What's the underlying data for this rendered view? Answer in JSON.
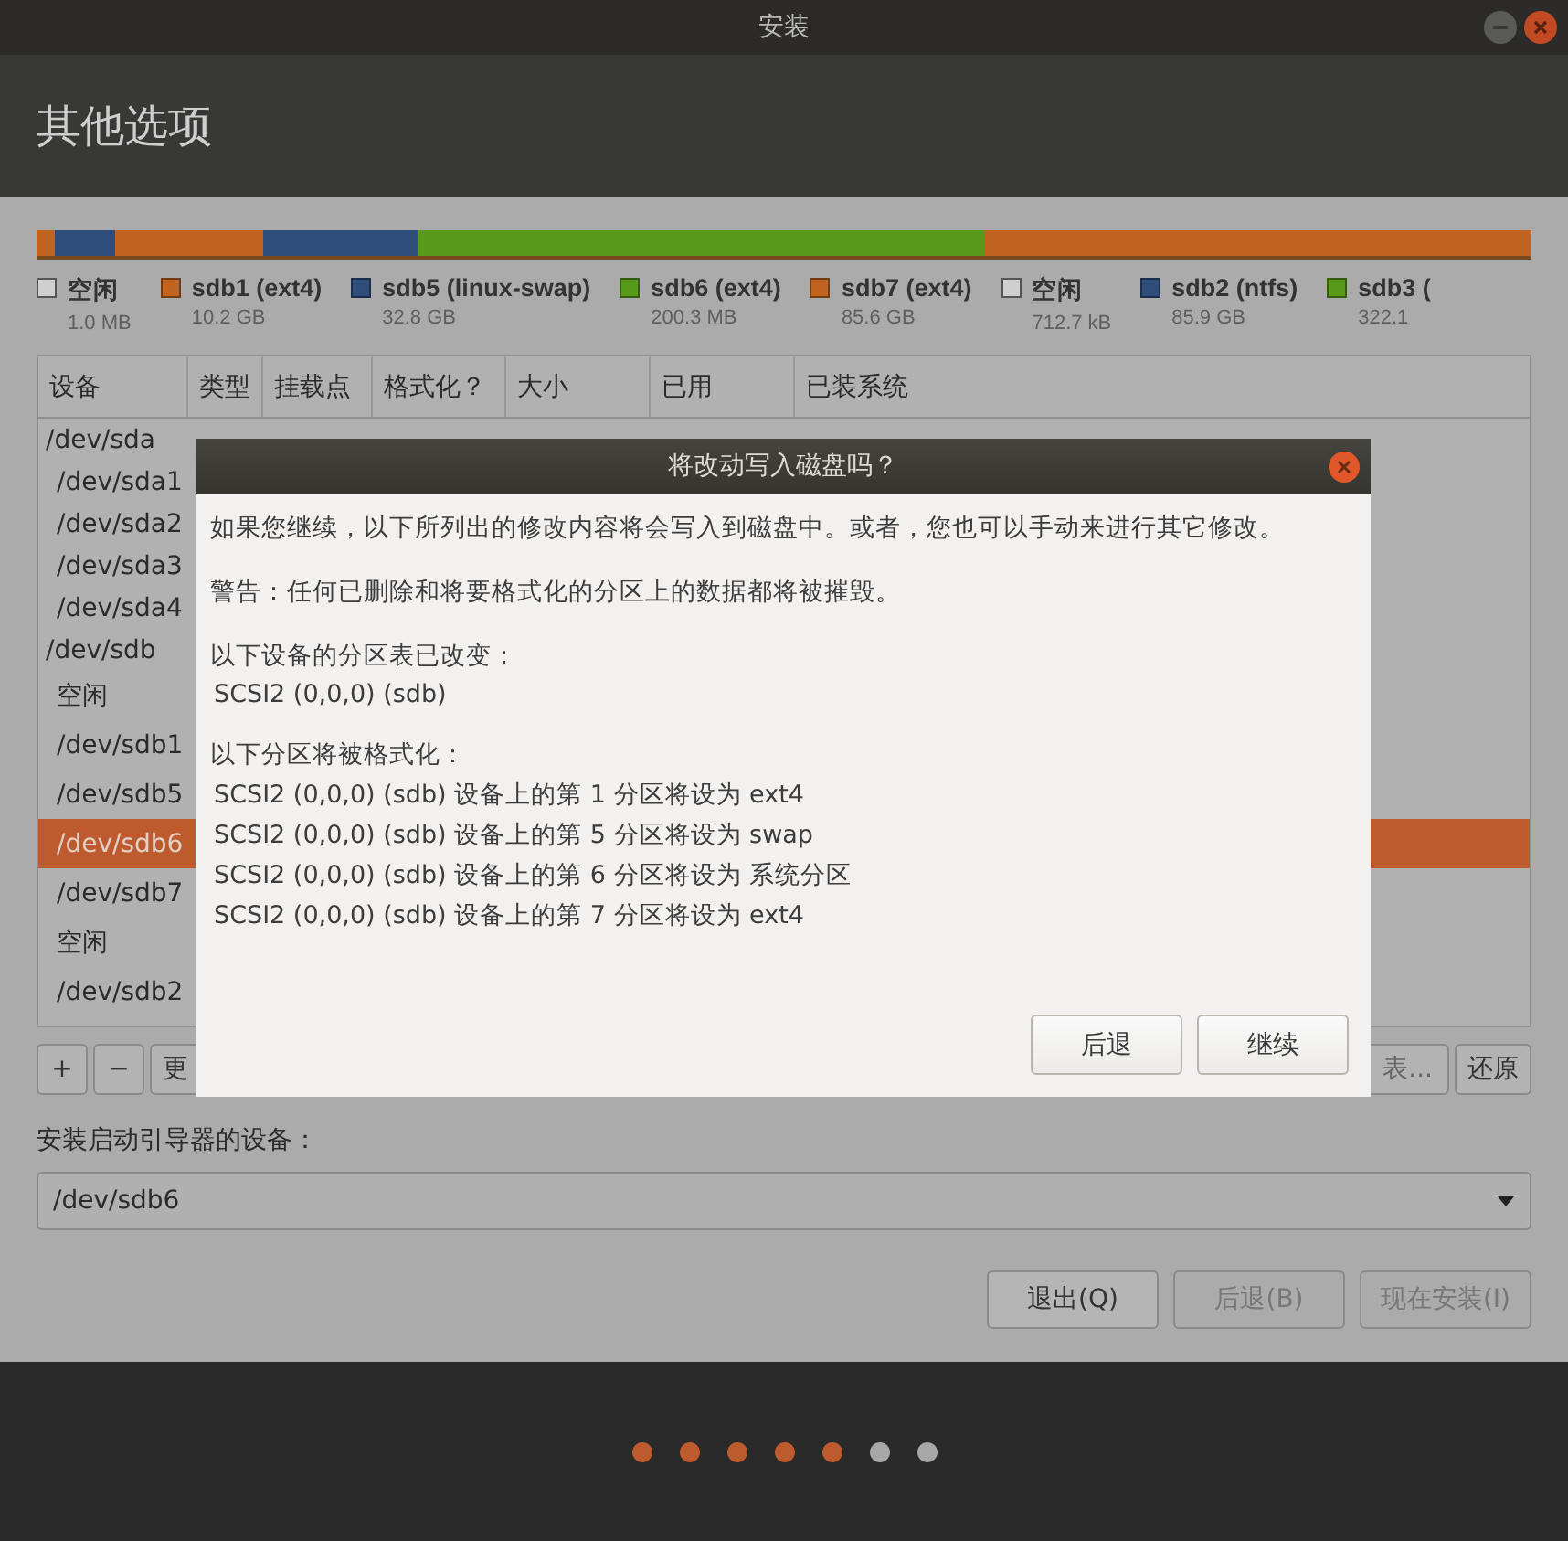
{
  "window": {
    "title": "安装"
  },
  "page_title": "其他选项",
  "legend": [
    {
      "kind": "free",
      "name": "空闲",
      "size": "1.0 MB"
    },
    {
      "kind": "part",
      "name": "sdb1 (ext4)",
      "size": "10.2 GB",
      "color": "#c0641f"
    },
    {
      "kind": "part",
      "name": "sdb5 (linux-swap)",
      "size": "32.8 GB",
      "color": "#2f4d7a"
    },
    {
      "kind": "part",
      "name": "sdb6 (ext4)",
      "size": "200.3 MB",
      "color": "#5a9a1a"
    },
    {
      "kind": "part",
      "name": "sdb7 (ext4)",
      "size": "85.6 GB",
      "color": "#c0641f"
    },
    {
      "kind": "free",
      "name": "空闲",
      "size": "712.7 kB"
    },
    {
      "kind": "part",
      "name": "sdb2 (ntfs)",
      "size": "85.9 GB",
      "color": "#2f4d7a"
    },
    {
      "kind": "part",
      "name": "sdb3 (",
      "size": "322.1",
      "color": "#5a9a1a"
    }
  ],
  "table": {
    "columns": [
      "设备",
      "类型",
      "挂载点",
      "格式化？",
      "大小",
      "已用",
      "已装系统"
    ],
    "rows": [
      {
        "device": "/dev/sda",
        "selected": false,
        "children": [
          {
            "device": "/dev/sda1",
            "selected": false
          },
          {
            "device": "/dev/sda2",
            "selected": false
          },
          {
            "device": "/dev/sda3",
            "selected": false
          },
          {
            "device": "/dev/sda4",
            "selected": false
          }
        ]
      },
      {
        "device": "/dev/sdb",
        "selected": false,
        "children": [
          {
            "device": "空闲",
            "selected": false
          },
          {
            "device": "/dev/sdb1",
            "selected": false
          },
          {
            "device": "/dev/sdb5",
            "selected": false
          },
          {
            "device": "/dev/sdb6",
            "selected": true
          },
          {
            "device": "/dev/sdb7",
            "selected": false
          },
          {
            "device": "空闲",
            "selected": false
          },
          {
            "device": "/dev/sdb2",
            "selected": false
          }
        ]
      }
    ]
  },
  "toolbar": {
    "left": [
      "+",
      "−",
      "更"
    ],
    "right": [
      "表...",
      "还原"
    ]
  },
  "bootloader": {
    "label": "安装启动引导器的设备：",
    "value": "/dev/sdb6"
  },
  "buttons": [
    {
      "label": "退出(Q)",
      "disabled": false
    },
    {
      "label": "后退(B)",
      "disabled": true
    },
    {
      "label": "现在安装(I)",
      "disabled": true
    }
  ],
  "steps": [
    {
      "done": true
    },
    {
      "done": true
    },
    {
      "done": true
    },
    {
      "done": true
    },
    {
      "done": true
    },
    {
      "done": false
    },
    {
      "done": false
    }
  ],
  "dialog": {
    "title": "将改动写入磁盘吗？",
    "intro": "如果您继续，以下所列出的修改内容将会写入到磁盘中。或者，您也可以手动来进行其它修改。",
    "warning": "警告：任何已删除和将要格式化的分区上的数据都将被摧毁。",
    "sections": [
      {
        "heading": "以下设备的分区表已改变：",
        "items": [
          "SCSI2 (0,0,0) (sdb)"
        ]
      },
      {
        "heading": "以下分区将被格式化：",
        "items": [
          "SCSI2 (0,0,0) (sdb) 设备上的第 1 分区将设为 ext4",
          "SCSI2 (0,0,0) (sdb) 设备上的第 5 分区将设为 swap",
          "SCSI2 (0,0,0) (sdb) 设备上的第 6 分区将设为 系统分区",
          "SCSI2 (0,0,0) (sdb) 设备上的第 7 分区将设为 ext4"
        ]
      }
    ],
    "buttons": [
      "后退",
      "继续"
    ]
  }
}
